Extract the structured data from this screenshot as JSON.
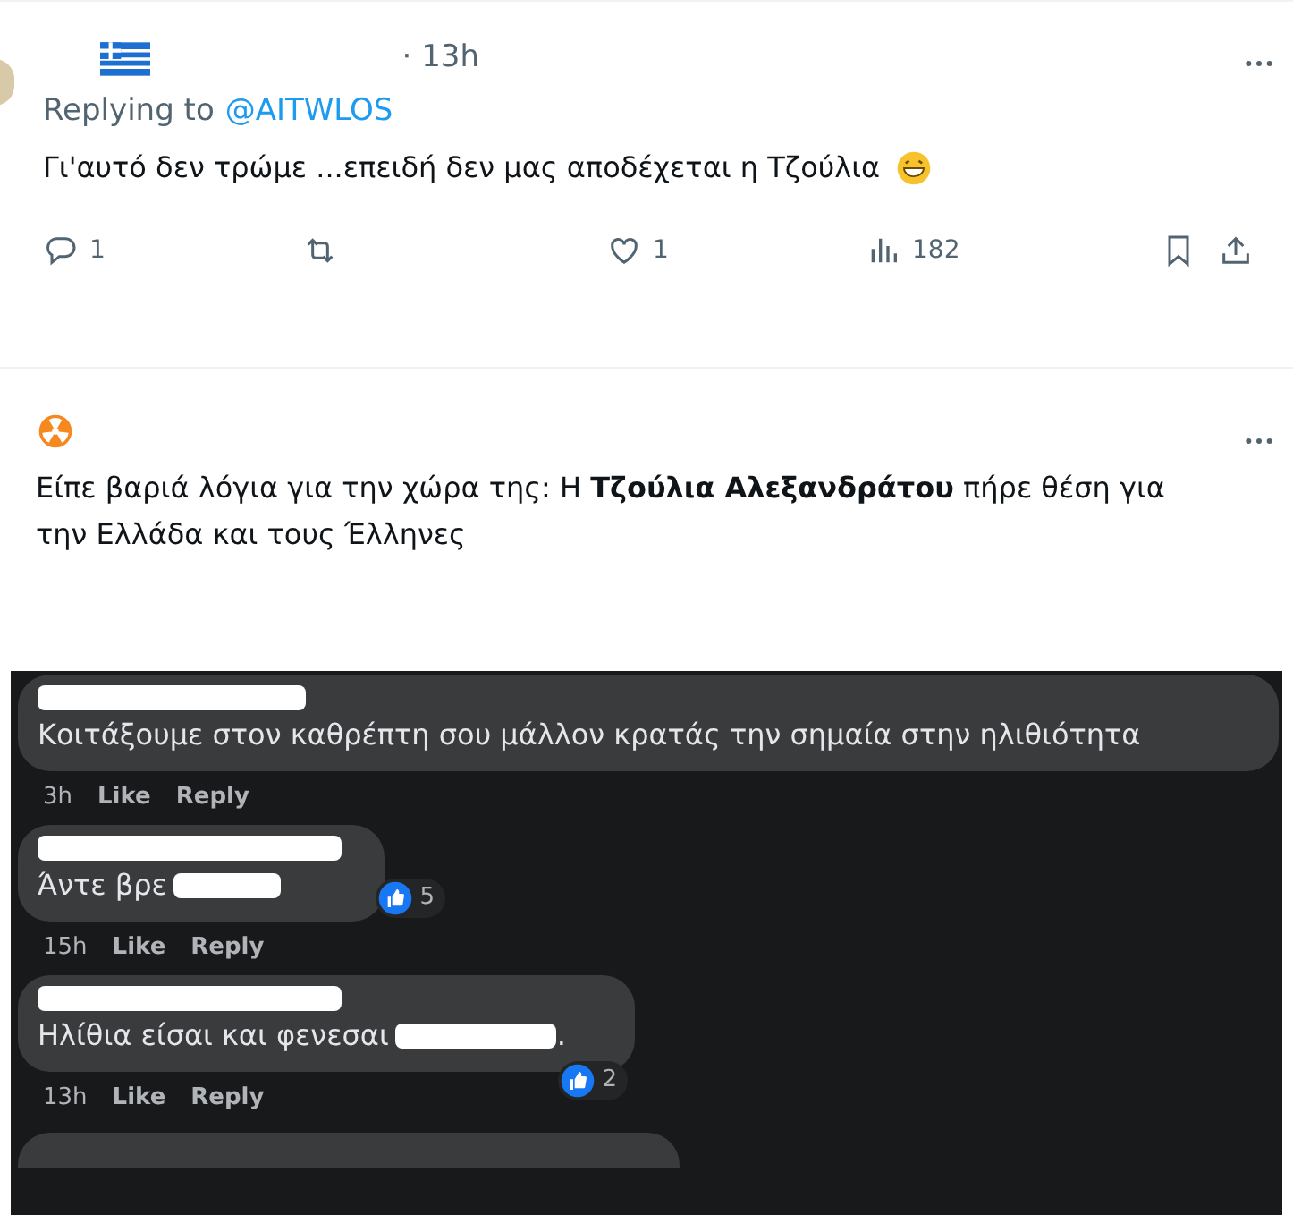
{
  "tweets": [
    {
      "time": "· 13h",
      "reply_prefix": "Replying to",
      "reply_handle": "@AITWLOS",
      "text": "Γι'αυτό δεν τρώμε ...επειδή δεν μας αποδέχεται η Τζούλια",
      "actions": [
        {
          "kind": "reply",
          "count": "1"
        },
        {
          "kind": "retweet"
        },
        {
          "kind": "like",
          "count": "1"
        },
        {
          "kind": "views",
          "count": "182"
        },
        {
          "kind": "bookmark"
        },
        {
          "kind": "share"
        }
      ]
    },
    {
      "text": "Είπε βαριά λόγια για την χώρα της: Η **Τζούλια Αλεξανδράτου** πήρε θέση για την Ελλάδα και τους Έλληνες"
    }
  ],
  "comments": [
    {
      "text": "Κοιτάξουμε στον καθρέπτη σου μάλλον κρατάς την σημαία στην ηλιθιότητα",
      "time": "3h",
      "like": "Like",
      "reply": "Reply"
    },
    {
      "text": "Άντε βρε",
      "reactions": "5",
      "time": "15h",
      "like": "Like",
      "reply": "Reply"
    },
    {
      "text": "Ηλίθια είσαι και φενεσαι",
      "end": ".",
      "reactions": "2",
      "time": "13h",
      "like": "Like",
      "reply": "Reply"
    }
  ]
}
